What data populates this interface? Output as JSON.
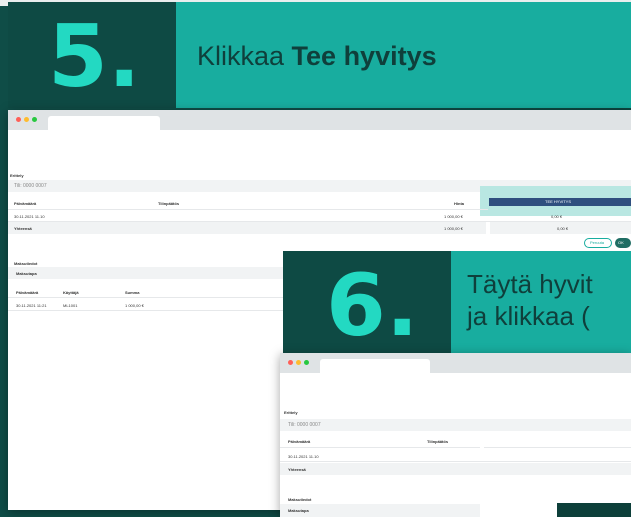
{
  "step5": {
    "number": "5.",
    "text_prefix": "Klikkaa ",
    "text_bold": "Tee hyvitys"
  },
  "step6": {
    "number": "6.",
    "line1": "Täytä hyvit",
    "line2": "ja klikkaa ("
  },
  "window1": {
    "section": "Erittely",
    "id": "Tili: 0000 0007",
    "col_a": "Päivämäärä",
    "col_b": "Tilinpäätös",
    "col_c": "Hinta",
    "row1_date": "30.11.2021 11.10",
    "row1_price": "1 000,00 €",
    "row1_extra": "0,00 €",
    "total_label": "Yhteensä",
    "total_price": "1 000,00 €",
    "total_extra": "0,00 €",
    "action_button": "TEE HYVITYS",
    "btn_left": "Peruuta",
    "btn_right": "OK",
    "payments_title": "Maksutiedot",
    "payments_sub": "Maksutapa",
    "pay_col1": "Päivämäärä",
    "pay_col2": "Käyttäjä",
    "pay_col3": "Summa",
    "pay_date": "30.11.2021 11:21",
    "pay_user": "ML1001",
    "pay_sum": "1 000,00 €"
  },
  "window2": {
    "section": "Erittely",
    "id": "Tili: 0000 0007",
    "col_a": "Päivämäärä",
    "col_b": "Tilinpäätös",
    "row1_date": "30.11.2021 11.10",
    "total_label": "Yhteensä",
    "payments_title": "Maksutiedot",
    "payments_sub": "Maksutapa"
  }
}
